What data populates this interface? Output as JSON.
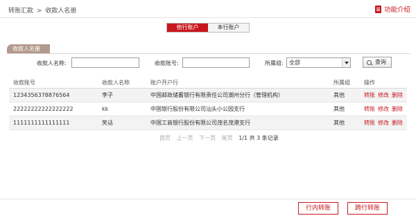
{
  "breadcrumb": {
    "parent": "转账汇款",
    "separator": ">",
    "current": "收款人名册"
  },
  "help": {
    "label": "功能介绍",
    "icon": "book-icon"
  },
  "tabs": [
    {
      "label": "他行账户",
      "active": true
    },
    {
      "label": "本行账户",
      "active": false
    }
  ],
  "section": {
    "title": "收款人名册"
  },
  "filters": {
    "name_label": "收款人名称:",
    "name_value": "",
    "account_label": "收款账号:",
    "account_value": "",
    "group_label": "所属组:",
    "group_selected": "全部",
    "search_label": "查询",
    "search_icon": "search-icon"
  },
  "table": {
    "headers": [
      "收款账号",
      "收款人名称",
      "账户开户行",
      "所属组",
      "操作"
    ],
    "rows": [
      {
        "account": "1234356378876564",
        "name": "李子",
        "bank": "中国邮政储蓄银行有限责任公司潮州分行（管理机构）",
        "group": "其他",
        "ops": [
          "转账",
          "修改",
          "删除"
        ]
      },
      {
        "account": "22222222222222222",
        "name": "kk",
        "bank": "中国银行股份有限公司汕头小公园支行",
        "group": "其他",
        "ops": [
          "转账",
          "修改",
          "删除"
        ]
      },
      {
        "account": "1111111111111111",
        "name": "笑话",
        "bank": "中国工商银行股份有限公司茂名茂港支行",
        "group": "其他",
        "ops": [
          "转账",
          "修改",
          "删除"
        ]
      }
    ]
  },
  "pager": {
    "first": "首页",
    "prev": "上一页",
    "next": "下一页",
    "last": "尾页",
    "count": "1/1 共 3 条记录"
  },
  "actions": {
    "intra_bank": "行内转账",
    "inter_bank": "跨行转账"
  },
  "colors": {
    "accent": "#c8161d",
    "tag": "#b39a8c"
  }
}
